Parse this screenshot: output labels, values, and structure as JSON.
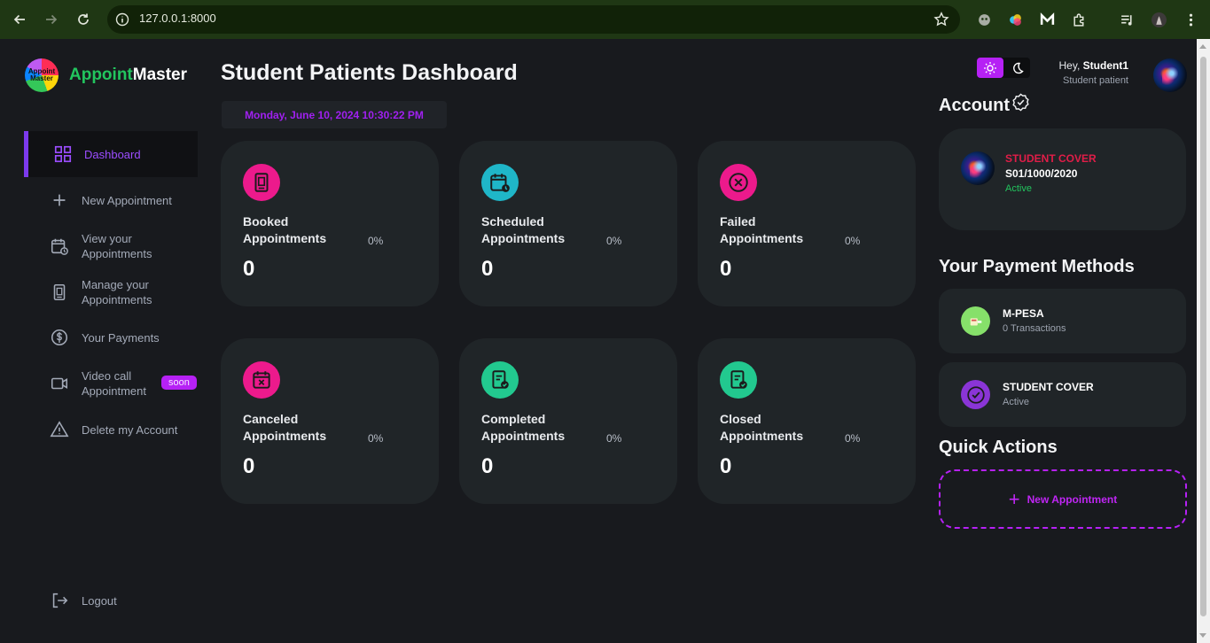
{
  "browser": {
    "url": "127.0.0.1:8000"
  },
  "brand": {
    "logo_text": "Appoint Master",
    "name_part1": "Appoint",
    "name_part2": "Master"
  },
  "sidebar": {
    "items": [
      {
        "label": "Dashboard",
        "icon": "grid-icon",
        "active": true
      },
      {
        "label": "New Appointment",
        "icon": "plus-icon"
      },
      {
        "label": "View your Appointments",
        "icon": "calendar-clock-icon"
      },
      {
        "label": "Manage your Appointments",
        "icon": "document-icon"
      },
      {
        "label": "Your Payments",
        "icon": "dollar-icon"
      },
      {
        "label": "Video call Appointment",
        "icon": "video-icon",
        "badge": "soon"
      },
      {
        "label": "Delete my Account",
        "icon": "warning-icon"
      }
    ],
    "logout_label": "Logout"
  },
  "main": {
    "title": "Student Patients Dashboard",
    "datetime": "Monday, June 10, 2024 10:30:22 PM",
    "cards": [
      {
        "title": "Booked Appointments",
        "percent": "0%",
        "value": "0",
        "icon": "document-icon",
        "color": "#ec1a8c"
      },
      {
        "title": "Scheduled Appointments",
        "percent": "0%",
        "value": "0",
        "icon": "calendar-clock-icon",
        "color": "#1fb6c8"
      },
      {
        "title": "Failed Appointments",
        "percent": "0%",
        "value": "0",
        "icon": "close-circle-icon",
        "color": "#ec1a8c"
      },
      {
        "title": "Canceled Appointments",
        "percent": "0%",
        "value": "0",
        "icon": "calendar-x-icon",
        "color": "#ec1a8c"
      },
      {
        "title": "Completed Appointments",
        "percent": "0%",
        "value": "0",
        "icon": "clipboard-check-icon",
        "color": "#22c98f"
      },
      {
        "title": "Closed Appointments",
        "percent": "0%",
        "value": "0",
        "icon": "clipboard-check-icon",
        "color": "#22c98f"
      }
    ]
  },
  "user": {
    "greeting": "Hey,",
    "name": "Student1",
    "role": "Student patient"
  },
  "account": {
    "section_title": "Account",
    "cover_name": "STUDENT COVER",
    "cover_id": "S01/1000/2020",
    "status": "Active"
  },
  "payments": {
    "section_title": "Your Payment Methods",
    "methods": [
      {
        "title": "M-PESA",
        "sub": "0 Transactions",
        "icon": "mpesa-icon",
        "color": "#86e06a"
      },
      {
        "title": "STUDENT COVER",
        "sub": "Active",
        "icon": "check-circle-icon",
        "color": "#8a35d6"
      }
    ]
  },
  "quick_actions": {
    "section_title": "Quick Actions",
    "new_appointment_label": "New Appointment"
  },
  "colors": {
    "accent": "#b621f5",
    "background": "#181a1e",
    "card": "#202528",
    "success": "#22c55e",
    "danger": "#e11d48"
  }
}
